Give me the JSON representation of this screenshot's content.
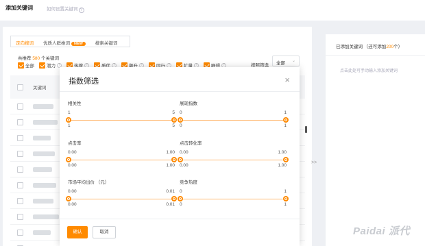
{
  "header": {
    "title": "添加关键词",
    "help": "如何设置关键词",
    "help_icon": "?"
  },
  "tabs": [
    {
      "label": "定向搜词",
      "active": true
    },
    {
      "label": "优质人群推词",
      "badge": "NEW"
    },
    {
      "label": "搜索关键词"
    }
  ],
  "recommend": {
    "prefix": "共推荐",
    "count": "580",
    "suffix": "个关键词"
  },
  "filters": [
    {
      "label": "全部",
      "checked": true
    },
    {
      "label": "潜力",
      "checked": true
    },
    {
      "label": "热搜",
      "checked": true
    },
    {
      "label": "质优",
      "checked": true
    },
    {
      "label": "飙升",
      "checked": true
    },
    {
      "label": "同行",
      "checked": true
    },
    {
      "label": "扩量",
      "checked": true
    },
    {
      "label": "联想",
      "checked": true
    }
  ],
  "sort": {
    "label": "按照筛选",
    "value": "全部"
  },
  "table": {
    "header": "关键词"
  },
  "right_panel": {
    "prefix": "已添加关键词 （还可添加",
    "count": "200",
    "suffix": "个）",
    "hint": "点击此处可手动输入添加关键词"
  },
  "transfer_arrows": ">>",
  "watermark": "Paidai 派代",
  "modal": {
    "title": "指数筛选",
    "close_icon": "×",
    "sliders": [
      {
        "name": "相关性",
        "top_min": "1",
        "top_max": "5",
        "bottom_min": "1",
        "bottom_max": "5"
      },
      {
        "name": "展现指数",
        "top_min": "0",
        "top_max": "1",
        "bottom_min": "0",
        "bottom_max": "1"
      },
      {
        "name": "点击率",
        "top_min": "0.00",
        "top_max": "1.00",
        "bottom_min": "0.00",
        "bottom_max": "1.00"
      },
      {
        "name": "点击转化率",
        "top_min": "0.00",
        "top_max": "1.00",
        "bottom_min": "0.00",
        "bottom_max": "1.00"
      },
      {
        "name": "市场平均出价 （元）",
        "top_min": "0.00",
        "top_max": "0.01",
        "bottom_min": "0.00",
        "bottom_max": "0.01"
      },
      {
        "name": "竞争热度",
        "top_min": "0",
        "top_max": "1",
        "bottom_min": "0",
        "bottom_max": "1"
      }
    ],
    "confirm": "确认",
    "cancel": "取消"
  },
  "colors": {
    "accent": "#ff8a00"
  }
}
